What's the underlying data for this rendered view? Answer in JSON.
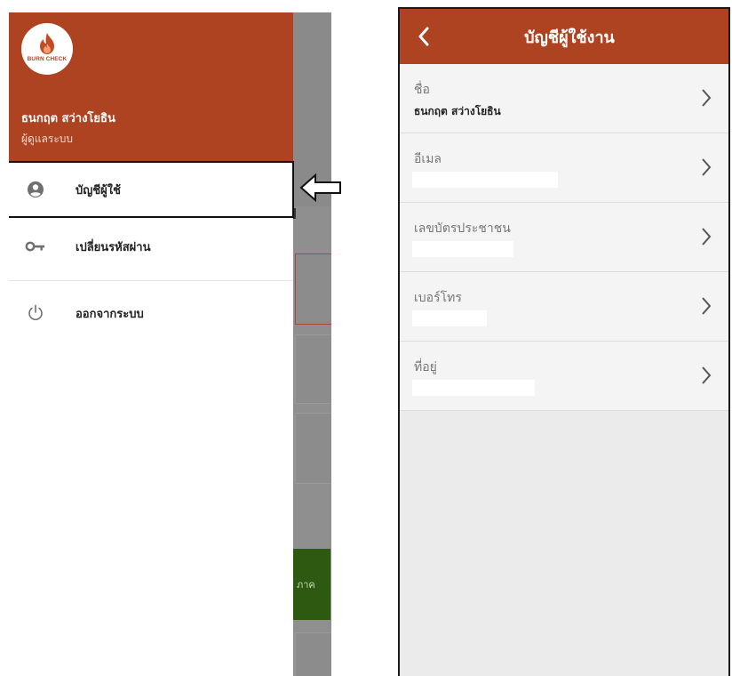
{
  "left_screen": {
    "logo": {
      "text": "BURN CHECK",
      "icon": "flame-icon"
    },
    "user": {
      "name": "ธนกฤต สว่างโยธิน",
      "role": "ผู้ดูแลระบบ"
    },
    "menu": [
      {
        "label": "บัญชีผู้ใช้",
        "icon": "account-circle-icon"
      },
      {
        "label": "เปลี่ยนรหัสผ่าน",
        "icon": "key-icon"
      },
      {
        "label": "ออกจากระบบ",
        "icon": "power-icon"
      }
    ],
    "background_button_text": "ภาค"
  },
  "right_screen": {
    "title": "บัญชีผู้ใช้งาน",
    "back_icon": "chevron-left-icon",
    "fields": [
      {
        "label": "ชื่อ",
        "value": "ธนกฤต สว่างโยธิน"
      },
      {
        "label": "อีเมล",
        "value": ""
      },
      {
        "label": "เลขบัตรประชาชน",
        "value": ""
      },
      {
        "label": "เบอร์โทร",
        "value": ""
      },
      {
        "label": "ที่อยู่",
        "value": ""
      }
    ]
  },
  "colors": {
    "brand": "#ae4322",
    "scrim": "#8f8f8f",
    "green_button": "#2d5a10"
  }
}
